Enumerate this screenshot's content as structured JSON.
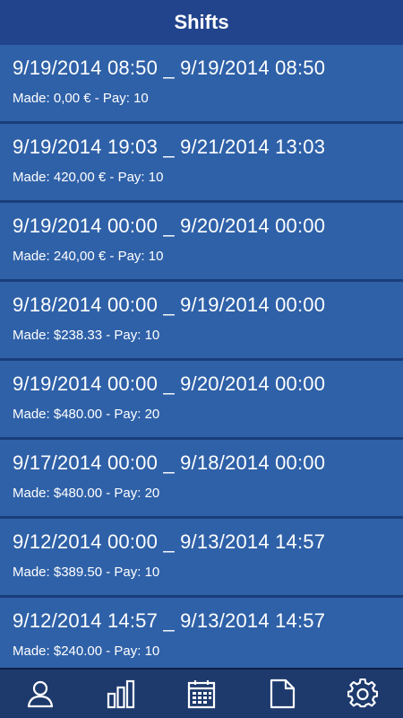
{
  "header": {
    "title": "Shifts"
  },
  "shifts": [
    {
      "dates": "9/19/2014 08:50 _ 9/19/2014 08:50",
      "summary": "Made: 0,00 € - Pay: 10"
    },
    {
      "dates": "9/19/2014 19:03 _ 9/21/2014 13:03",
      "summary": "Made: 420,00 € - Pay: 10"
    },
    {
      "dates": "9/19/2014 00:00 _ 9/20/2014 00:00",
      "summary": "Made: 240,00 € - Pay: 10"
    },
    {
      "dates": "9/18/2014 00:00 _ 9/19/2014 00:00",
      "summary": "Made: $238.33 - Pay: 10"
    },
    {
      "dates": "9/19/2014 00:00 _ 9/20/2014 00:00",
      "summary": "Made: $480.00 - Pay: 20"
    },
    {
      "dates": "9/17/2014 00:00 _ 9/18/2014 00:00",
      "summary": "Made: $480.00 - Pay: 20"
    },
    {
      "dates": "9/12/2014 00:00 _ 9/13/2014 14:57",
      "summary": "Made: $389.50 - Pay: 10"
    },
    {
      "dates": "9/12/2014 14:57 _ 9/13/2014 14:57",
      "summary": "Made: $240.00 - Pay: 10"
    }
  ],
  "tabbar": {
    "items": [
      {
        "icon": "person-icon"
      },
      {
        "icon": "bar-chart-icon"
      },
      {
        "icon": "calendar-icon"
      },
      {
        "icon": "document-icon"
      },
      {
        "icon": "gear-icon"
      }
    ]
  },
  "colors": {
    "header": "#22448c",
    "row": "#2f61a8",
    "separator": "#1a3d7a",
    "tabbar": "#1e3a6d"
  }
}
